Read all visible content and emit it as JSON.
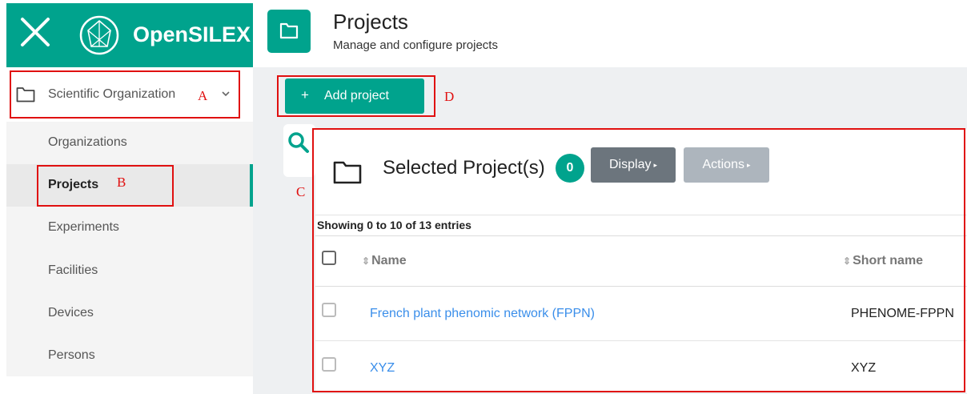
{
  "brand": {
    "title": "OpenSILEX",
    "close_icon": "close-icon",
    "logo_icon": "opensilex-logo"
  },
  "sidebar": {
    "group": {
      "label": "Scientific Organization",
      "icon": "folder-icon",
      "chevron": "chevron-down-icon"
    },
    "items": [
      {
        "label": "Organizations"
      },
      {
        "label": "Projects",
        "active": true
      },
      {
        "label": "Experiments"
      },
      {
        "label": "Facilities"
      },
      {
        "label": "Devices"
      },
      {
        "label": "Persons"
      }
    ]
  },
  "header": {
    "title": "Projects",
    "subtitle": "Manage and configure projects",
    "icon": "folder-icon"
  },
  "toolbar": {
    "add_icon": "+",
    "add_label": "Add project"
  },
  "card": {
    "title": "Selected Project(s)",
    "count": "0",
    "display_label": "Display",
    "actions_label": "Actions",
    "caret": "▸",
    "showing": "Showing 0 to 10 of 13 entries"
  },
  "table": {
    "columns": [
      {
        "label": "Name",
        "sort_icon": "⇕"
      },
      {
        "label": "Short name",
        "sort_icon": "⇕"
      }
    ],
    "rows": [
      {
        "name": "French plant phenomic network (FPPN)",
        "short_name": "PHENOME-FPPN"
      },
      {
        "name": "XYZ",
        "short_name": "XYZ"
      }
    ]
  },
  "annotations": {
    "a": "A",
    "b": "B",
    "c": "C",
    "d": "D"
  },
  "colors": {
    "accent": "#00a38d",
    "link": "#3a8eea",
    "annotation": "#e01010",
    "display_button": "#6c757d",
    "actions_button": "#adb5bd"
  }
}
